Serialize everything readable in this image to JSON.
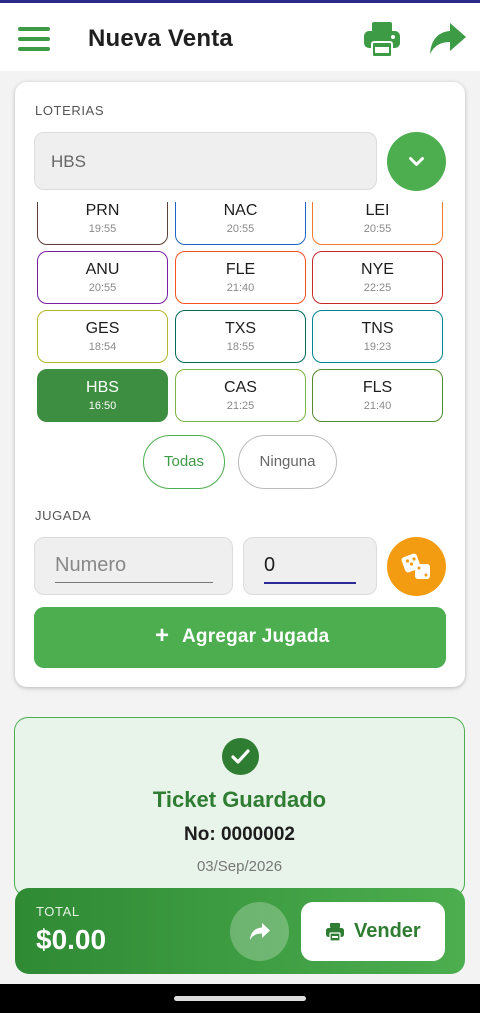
{
  "appbar": {
    "title": "Nueva Venta",
    "accent": "#3d9a45"
  },
  "loterias": {
    "section_label": "LOTERIAS",
    "selected_value": "HBS",
    "items": [
      {
        "code": "PRN",
        "time": "19:55",
        "color": "#5d4037",
        "selected": false
      },
      {
        "code": "NAC",
        "time": "20:55",
        "color": "#1e64c8",
        "selected": false
      },
      {
        "code": "LEI",
        "time": "20:55",
        "color": "#f07a2a",
        "selected": false
      },
      {
        "code": "ANU",
        "time": "20:55",
        "color": "#7b1fa2",
        "selected": false
      },
      {
        "code": "FLE",
        "time": "21:40",
        "color": "#f4511e",
        "selected": false
      },
      {
        "code": "NYE",
        "time": "22:25",
        "color": "#c62828",
        "selected": false
      },
      {
        "code": "GES",
        "time": "18:54",
        "color": "#b5b52b",
        "selected": false
      },
      {
        "code": "TXS",
        "time": "18:55",
        "color": "#00695c",
        "selected": false
      },
      {
        "code": "TNS",
        "time": "19:23",
        "color": "#00838f",
        "selected": false
      },
      {
        "code": "HBS",
        "time": "16:50",
        "color": "#3e8e41",
        "selected": true
      },
      {
        "code": "CAS",
        "time": "21:25",
        "color": "#7cb342",
        "selected": false
      },
      {
        "code": "FLS",
        "time": "21:40",
        "color": "#558b2f",
        "selected": false
      }
    ],
    "select_all_label": "Todas",
    "select_none_label": "Ninguna"
  },
  "jugada": {
    "section_label": "JUGADA",
    "numero_placeholder": "Numero",
    "monto_value": "0",
    "add_label": "Agregar Jugada",
    "add_icon": "+"
  },
  "ticket": {
    "title": "Ticket Guardado",
    "number": "No: 0000002",
    "date": "03/Sep/2026"
  },
  "footer": {
    "total_label": "TOTAL",
    "total_value": "$0.00",
    "sell_label": "Vender"
  }
}
